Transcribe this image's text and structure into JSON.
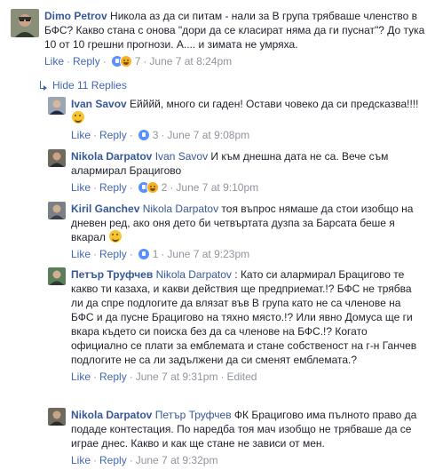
{
  "comments": [
    {
      "author": "Dimo Petrov",
      "text": "Никола аз да си питам - нали за В група трябваше членство в БФС? Какво стана с онова \"дори да се класират няма да ги пуснат\"? До тука 10 от 10 грешни прогнози. А.... и зимата не умряха.",
      "like": "Like",
      "reply": "Reply",
      "reaction_count": "7",
      "time": "June 7 at 8:24pm"
    }
  ],
  "hide_replies_label": "Hide 11 Replies",
  "replies": [
    {
      "author": "Ivan Savov",
      "mention": "",
      "text_1": "Ейййй, много си гаден! Остави човеко да си предсказва!!!!",
      "like": "Like",
      "reply": "Reply",
      "reaction_count": "3",
      "time": "June 7 at 9:08pm"
    },
    {
      "author": "Nikola Darpatov",
      "mention": "Ivan Savov",
      "text_1": " И към днешна дата не са. Вече съм алармирал Брацигово",
      "like": "Like",
      "reply": "Reply",
      "reaction_count": "2",
      "time": "June 7 at 9:10pm"
    },
    {
      "author": "Kiril Ganchev",
      "mention": "Nikola Darpatov",
      "text_1": " тоя въпрос нямаше да стои изобщо на дневен ред, ако оня дето би четвъртата дузпа за Барсата беше я вкарал",
      "like": "Like",
      "reply": "Reply",
      "reaction_count": "1",
      "time": "June 7 at 9:23pm"
    },
    {
      "author": "Петър Труфчев",
      "mention": "Nikola Darpatov",
      "text_1": " : Като си алармирал Брацигово те какво ти казаха, и какви действия ще предприемат.!? БФС не трябва ли да спре подлогите да влязат във В група като не са членове на БФС и да пусне Брацигово на тяхно място.!? Или явно Домуса ще ги вкара където си поиска без да са членове на БФС.!? Когато официално се плати за емблемата и стане собственост на г-н Ганчев подлогите не са ли задължени да си сменят емблемата.?",
      "like": "Like",
      "reply": "Reply",
      "time": "June 7 at 9:31pm",
      "edited": "Edited"
    },
    {
      "author": "Nikola Darpatov",
      "mention": "Петър Труфчев",
      "text_1": " ФК Брацигово има пълното право да подаде контестация. По наредба тоя мач изобщо не трябваше да се играе днес. Какво и как ще стане не зависи от мен.",
      "like": "Like",
      "reply": "Reply",
      "time": "June 7 at 9:32pm"
    }
  ],
  "colors": {
    "link": "#365899",
    "meta_link": "#4267b2",
    "meta_gray": "#90949c",
    "like_reaction": "#5890ff",
    "haha_reaction": "#f7b125"
  },
  "icons": [
    "like-reaction-icon",
    "haha-reaction-icon",
    "smile-emoji-icon",
    "reply-arrow-icon"
  ]
}
